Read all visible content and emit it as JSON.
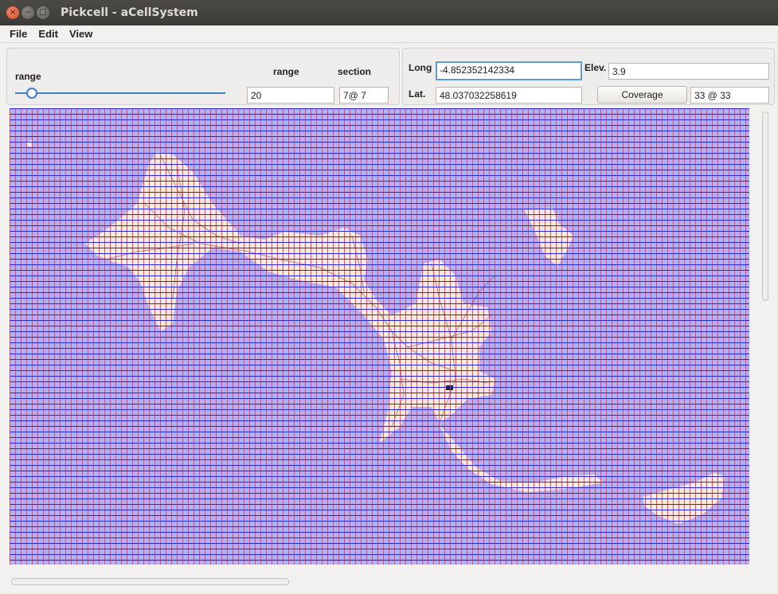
{
  "window": {
    "title": "Pickcell - aCellSystem",
    "buttons": {
      "close": "close-icon",
      "minimize": "minimize-icon",
      "maximize": "maximize-icon"
    }
  },
  "menubar": {
    "items": [
      "File",
      "Edit",
      "View"
    ]
  },
  "controls": {
    "range_slider_label": "range",
    "range_slider_value": 0.08,
    "range_label": "range",
    "range_value": "20",
    "section_label": "section",
    "section_value": "7@ 7"
  },
  "location": {
    "long_label": "Long",
    "long_value": "-4.852352142334",
    "lat_label": "Lat.",
    "lat_value": "48.037032258619",
    "elev_label": "Elev.",
    "elev_value": "3.9",
    "coverage_button": "Coverage",
    "coverage_value": "33 @ 33"
  },
  "map": {
    "grid_color": "#2a2acc",
    "grid_line_color": "#ff3a3a",
    "land_color": "#ffeeee",
    "background_color": "#b0b0ff"
  }
}
